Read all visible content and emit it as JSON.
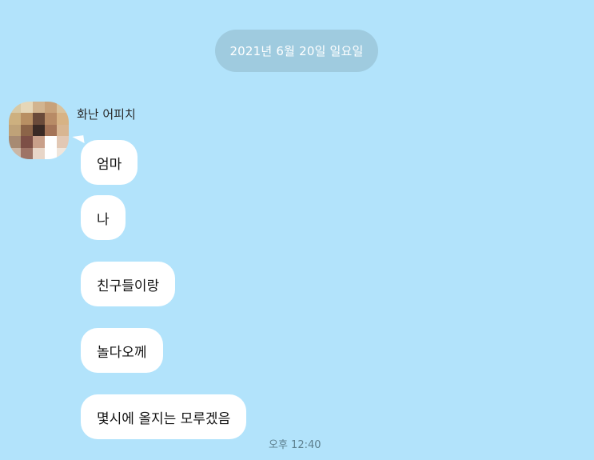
{
  "date_separator": "2021년 6월 20일 일요일",
  "sender": {
    "name": "화난 어피치",
    "avatar_icon": "pixelated-profile-photo"
  },
  "messages": [
    {
      "text": "엄마"
    },
    {
      "text": "나"
    },
    {
      "text": "친구들이랑"
    },
    {
      "text": "놀다오께"
    },
    {
      "text": "몇시에 올지는 모루겠음"
    }
  ],
  "last_time": "오후 12:40",
  "colors": {
    "background": "#b2e3fb",
    "date_pill": "#9fcbdf",
    "bubble": "#ffffff"
  }
}
